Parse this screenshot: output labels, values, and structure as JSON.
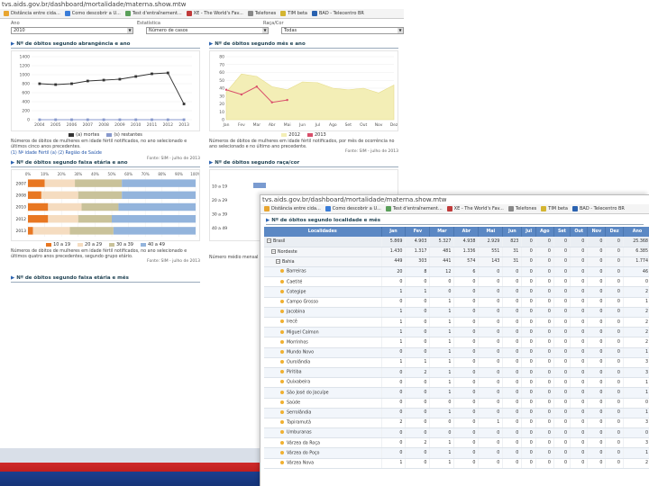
{
  "back": {
    "url": "tvs.aids.gov.br/dashboard/mortalidade/materna.show.mtw",
    "bookmarks": [
      "Distância entre cida...",
      "Como descobrir a U...",
      "Test d'entraînement...",
      "XE - The World's Fav...",
      "Telefones",
      "TIM beta",
      "BAD - Telecentro BR"
    ],
    "filters": {
      "labels": [
        "Ano",
        "Estatística",
        "Raça/Cor"
      ],
      "values": [
        "2010",
        "Número de casos",
        "Todas"
      ]
    },
    "panel1": {
      "title": "Nº de óbitos segundo abrangência e ano",
      "legend": [
        "(a) mortes",
        "(s) restantes"
      ],
      "note": "Números de óbitos de mulheres em idade fértil notificados, no ano selecionado e últimos cinco anos precedentes.",
      "note_link": "(1) Nº idade Fértil (a)  (2) Região de Saúde",
      "source": "Fonte: SIM - julho de 2013"
    },
    "panel2": {
      "title": "Nº de óbitos segundo mês e ano",
      "legend": [
        "2012",
        "2013"
      ],
      "note": "Números de óbitos de mulheres em idade fértil notificados, por mês de ocorrência no ano selecionado e no último ano precedente.",
      "source": "Fonte: SIM - julho de 2013"
    },
    "panel3": {
      "title": "Nº de óbitos segundo faixa etária e ano",
      "legend": [
        "10 a 19",
        "20 a 29",
        "30 a 39",
        "40 a 49"
      ],
      "note": "Números de óbitos de mulheres em idade fértil notificados, no ano selecionado e últimos quatro anos precedentes, segundo grupo etário.",
      "source": "Fonte: SIM - julho de 2013"
    },
    "panel4": {
      "title": "Nº de óbitos segundo raça/cor",
      "note": "Número médio mensal de óbitos... no ano selecionado e últimos anos precedentes.",
      "source": ""
    },
    "panel5": {
      "title": "Nº de óbitos segundo faixa etária e mês"
    }
  },
  "front": {
    "url": "tvs.aids.gov.br/dashboard/mortalidade/materna.show.mtw",
    "bookmarks": [
      "Distância entre cida...",
      "Como descobrir a U...",
      "Test d'entraînement...",
      "XE - The World's Fav...",
      "Telefones",
      "TIM beta",
      "BAD - Telecentro BR"
    ],
    "panel_title": "Nº de óbitos segundo localidade e mês",
    "columns": [
      "Localidades",
      "Jan",
      "Fev",
      "Mar",
      "Abr",
      "Mai",
      "Jun",
      "Jul",
      "Ago",
      "Set",
      "Out",
      "Nov",
      "Dez",
      "Ano"
    ],
    "rows": [
      {
        "name": "Brasil",
        "level": 0,
        "values": [
          "5.869",
          "4.903",
          "5.327",
          "4.938",
          "2.929",
          "823",
          "0",
          "0",
          "0",
          "0",
          "0",
          "0",
          "25.368"
        ]
      },
      {
        "name": "Nordeste",
        "level": 1,
        "values": [
          "1.430",
          "1.317",
          "481",
          "1.336",
          "551",
          "31",
          "0",
          "0",
          "0",
          "0",
          "0",
          "0",
          "6.385"
        ]
      },
      {
        "name": "Bahia",
        "level": 2,
        "values": [
          "449",
          "303",
          "441",
          "574",
          "143",
          "31",
          "0",
          "0",
          "0",
          "0",
          "0",
          "0",
          "1.774"
        ]
      },
      {
        "name": "Barreiras",
        "level": 3,
        "values": [
          "20",
          "8",
          "12",
          "6",
          "0",
          "0",
          "0",
          "0",
          "0",
          "0",
          "0",
          "0",
          "46"
        ]
      },
      {
        "name": "Caetité",
        "level": 3,
        "values": [
          "0",
          "0",
          "0",
          "0",
          "0",
          "0",
          "0",
          "0",
          "0",
          "0",
          "0",
          "0",
          "0"
        ]
      },
      {
        "name": "Cotegipe",
        "level": 3,
        "values": [
          "1",
          "1",
          "0",
          "0",
          "0",
          "0",
          "0",
          "0",
          "0",
          "0",
          "0",
          "0",
          "2"
        ]
      },
      {
        "name": "Campo Grosso",
        "level": 3,
        "values": [
          "0",
          "0",
          "1",
          "0",
          "0",
          "0",
          "0",
          "0",
          "0",
          "0",
          "0",
          "0",
          "1"
        ]
      },
      {
        "name": "Jacobina",
        "level": 3,
        "values": [
          "1",
          "0",
          "1",
          "0",
          "0",
          "0",
          "0",
          "0",
          "0",
          "0",
          "0",
          "0",
          "2"
        ]
      },
      {
        "name": "Irecê",
        "level": 3,
        "values": [
          "1",
          "0",
          "1",
          "0",
          "0",
          "0",
          "0",
          "0",
          "0",
          "0",
          "0",
          "0",
          "2"
        ]
      },
      {
        "name": "Miguel Calmon",
        "level": 3,
        "values": [
          "1",
          "0",
          "1",
          "0",
          "0",
          "0",
          "0",
          "0",
          "0",
          "0",
          "0",
          "0",
          "2"
        ]
      },
      {
        "name": "Morrinhos",
        "level": 3,
        "values": [
          "1",
          "0",
          "1",
          "0",
          "0",
          "0",
          "0",
          "0",
          "0",
          "0",
          "0",
          "0",
          "2"
        ]
      },
      {
        "name": "Mundo Novo",
        "level": 3,
        "values": [
          "0",
          "0",
          "1",
          "0",
          "0",
          "0",
          "0",
          "0",
          "0",
          "0",
          "0",
          "0",
          "1"
        ]
      },
      {
        "name": "Ourolândia",
        "level": 3,
        "values": [
          "1",
          "1",
          "1",
          "0",
          "0",
          "0",
          "0",
          "0",
          "0",
          "0",
          "0",
          "0",
          "3"
        ]
      },
      {
        "name": "Piritiba",
        "level": 3,
        "values": [
          "0",
          "2",
          "1",
          "0",
          "0",
          "0",
          "0",
          "0",
          "0",
          "0",
          "0",
          "0",
          "3"
        ]
      },
      {
        "name": "Quixabeira",
        "level": 3,
        "values": [
          "0",
          "0",
          "1",
          "0",
          "0",
          "0",
          "0",
          "0",
          "0",
          "0",
          "0",
          "0",
          "1"
        ]
      },
      {
        "name": "São José do Jacuípe",
        "level": 3,
        "values": [
          "0",
          "0",
          "1",
          "0",
          "0",
          "0",
          "0",
          "0",
          "0",
          "0",
          "0",
          "0",
          "1"
        ]
      },
      {
        "name": "Saúde",
        "level": 3,
        "values": [
          "0",
          "0",
          "0",
          "0",
          "0",
          "0",
          "0",
          "0",
          "0",
          "0",
          "0",
          "0",
          "0"
        ]
      },
      {
        "name": "Serrolândia",
        "level": 3,
        "values": [
          "0",
          "0",
          "1",
          "0",
          "0",
          "0",
          "0",
          "0",
          "0",
          "0",
          "0",
          "0",
          "1"
        ]
      },
      {
        "name": "Tapiramutá",
        "level": 3,
        "values": [
          "2",
          "0",
          "0",
          "0",
          "1",
          "0",
          "0",
          "0",
          "0",
          "0",
          "0",
          "0",
          "3"
        ]
      },
      {
        "name": "Umburanas",
        "level": 3,
        "values": [
          "0",
          "0",
          "0",
          "0",
          "0",
          "0",
          "0",
          "0",
          "0",
          "0",
          "0",
          "0",
          "0"
        ]
      },
      {
        "name": "Várzea da Roça",
        "level": 3,
        "values": [
          "0",
          "2",
          "1",
          "0",
          "0",
          "0",
          "0",
          "0",
          "0",
          "0",
          "0",
          "0",
          "3"
        ]
      },
      {
        "name": "Várzea do Poço",
        "level": 3,
        "values": [
          "0",
          "0",
          "1",
          "0",
          "0",
          "0",
          "0",
          "0",
          "0",
          "0",
          "0",
          "0",
          "1"
        ]
      },
      {
        "name": "Várzea Nova",
        "level": 3,
        "values": [
          "1",
          "0",
          "1",
          "0",
          "0",
          "0",
          "0",
          "0",
          "0",
          "0",
          "0",
          "0",
          "2"
        ]
      }
    ]
  },
  "chart_data": [
    {
      "type": "line",
      "categories": [
        "2004",
        "2005",
        "2006",
        "2007",
        "2008",
        "2009",
        "2010",
        "2011",
        "2012",
        "2013"
      ],
      "series": [
        {
          "name": "(a) mortes",
          "values": [
            800,
            780,
            800,
            860,
            880,
            900,
            960,
            1020,
            1040,
            350
          ]
        },
        {
          "name": "(s) restantes",
          "values": [
            0,
            0,
            0,
            0,
            0,
            0,
            0,
            0,
            0,
            0
          ]
        }
      ],
      "ylim": [
        0,
        1400
      ],
      "yticks": [
        0,
        200,
        400,
        600,
        800,
        1000,
        1200,
        1400
      ],
      "colors": [
        "#333333",
        "#8899cc"
      ],
      "grid": true,
      "legend": "bottom"
    },
    {
      "type": "area",
      "categories": [
        "Jan",
        "Fev",
        "Mar",
        "Abr",
        "Mai",
        "Jun",
        "Jul",
        "Ago",
        "Set",
        "Out",
        "Nov",
        "Dez"
      ],
      "series": [
        {
          "name": "2012",
          "values": [
            35,
            58,
            55,
            42,
            38,
            48,
            47,
            40,
            38,
            40,
            34,
            44
          ]
        },
        {
          "name": "2013",
          "values": [
            38,
            32,
            42,
            22,
            25,
            null,
            null,
            null,
            null,
            null,
            null,
            null
          ]
        }
      ],
      "ylim": [
        0,
        80
      ],
      "yticks": [
        0,
        10,
        20,
        30,
        40,
        50,
        60,
        70,
        80
      ],
      "colors": [
        "#f3eeb6",
        "#d94f6b"
      ],
      "grid": true,
      "legend": "bottom"
    },
    {
      "type": "bar",
      "orientation": "horizontal-stacked-percent",
      "categories": [
        "2007",
        "2008",
        "2010",
        "2012",
        "2013"
      ],
      "series": [
        {
          "name": "10 a 19",
          "values": [
            10,
            8,
            12,
            12,
            3
          ]
        },
        {
          "name": "20 a 29",
          "values": [
            18,
            22,
            20,
            18,
            22
          ]
        },
        {
          "name": "30 a 39",
          "values": [
            28,
            26,
            22,
            20,
            26
          ]
        },
        {
          "name": "40 a 49",
          "values": [
            44,
            44,
            46,
            50,
            49
          ]
        }
      ],
      "xlim": [
        0,
        100
      ],
      "xticks": [
        "0%",
        "10%",
        "20%",
        "30%",
        "40%",
        "50%",
        "60%",
        "70%",
        "80%",
        "90%",
        "100%"
      ],
      "colors": [
        "#e87722",
        "#f5dcc0",
        "#c9c29a",
        "#93b4dc"
      ],
      "legend": "bottom"
    },
    {
      "type": "bar",
      "orientation": "horizontal",
      "categories": [
        "10 a 19",
        "20 a 29",
        "30 a 39",
        "40 a 49"
      ],
      "series": [
        {
          "name": "",
          "values": [
            null,
            null,
            null,
            null
          ]
        }
      ],
      "colors": [
        "#7a9bd0"
      ]
    }
  ]
}
